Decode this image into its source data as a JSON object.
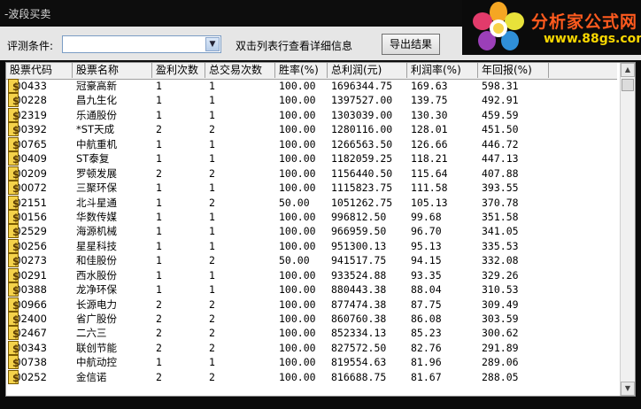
{
  "window": {
    "title": "-波段买卖"
  },
  "toolbar": {
    "condition_label": "评测条件:",
    "condition_value": "",
    "hint": "双击列表行查看详细信息",
    "export_label": "导出结果"
  },
  "logo": {
    "brand": "分析家公式网",
    "url": "www.88gs.com"
  },
  "table": {
    "columns": [
      "股票代码",
      "股票名称",
      "盈利次数",
      "总交易次数",
      "胜率(%)",
      "总利润(元)",
      "利润率(%)",
      "年回报(%)"
    ],
    "rows": [
      [
        "600433",
        "冠豪高新",
        "1",
        "1",
        "100.00",
        "1696344.75",
        "169.63",
        "598.31"
      ],
      [
        "600228",
        "昌九生化",
        "1",
        "1",
        "100.00",
        "1397527.00",
        "139.75",
        "492.91"
      ],
      [
        "002319",
        "乐通股份",
        "1",
        "1",
        "100.00",
        "1303039.00",
        "130.30",
        "459.59"
      ],
      [
        "600392",
        "*ST天成",
        "2",
        "2",
        "100.00",
        "1280116.00",
        "128.01",
        "451.50"
      ],
      [
        "600765",
        "中航重机",
        "1",
        "1",
        "100.00",
        "1266563.50",
        "126.66",
        "446.72"
      ],
      [
        "000409",
        "ST泰复",
        "1",
        "1",
        "100.00",
        "1182059.25",
        "118.21",
        "447.13"
      ],
      [
        "600209",
        "罗顿发展",
        "2",
        "2",
        "100.00",
        "1156440.50",
        "115.64",
        "407.88"
      ],
      [
        "300072",
        "三聚环保",
        "1",
        "1",
        "100.00",
        "1115823.75",
        "111.58",
        "393.55"
      ],
      [
        "002151",
        "北斗星通",
        "1",
        "2",
        "50.00",
        "1051262.75",
        "105.13",
        "370.78"
      ],
      [
        "000156",
        "华数传媒",
        "1",
        "1",
        "100.00",
        "996812.50",
        "99.68",
        "351.58"
      ],
      [
        "002529",
        "海源机械",
        "1",
        "1",
        "100.00",
        "966959.50",
        "96.70",
        "341.05"
      ],
      [
        "300256",
        "星星科技",
        "1",
        "1",
        "100.00",
        "951300.13",
        "95.13",
        "335.53"
      ],
      [
        "300273",
        "和佳股份",
        "1",
        "2",
        "50.00",
        "941517.75",
        "94.15",
        "332.08"
      ],
      [
        "600291",
        "西水股份",
        "1",
        "1",
        "100.00",
        "933524.88",
        "93.35",
        "329.26"
      ],
      [
        "600388",
        "龙净环保",
        "1",
        "1",
        "100.00",
        "880443.38",
        "88.04",
        "310.53"
      ],
      [
        "000966",
        "长源电力",
        "2",
        "2",
        "100.00",
        "877474.38",
        "87.75",
        "309.49"
      ],
      [
        "002400",
        "省广股份",
        "2",
        "2",
        "100.00",
        "860760.38",
        "86.08",
        "303.59"
      ],
      [
        "002467",
        "二六三",
        "2",
        "2",
        "100.00",
        "852334.13",
        "85.23",
        "300.62"
      ],
      [
        "300343",
        "联创节能",
        "2",
        "2",
        "100.00",
        "827572.50",
        "82.76",
        "291.89"
      ],
      [
        "000738",
        "中航动控",
        "1",
        "1",
        "100.00",
        "819554.63",
        "81.96",
        "289.06"
      ],
      [
        "300252",
        "金信诺",
        "2",
        "2",
        "100.00",
        "816688.75",
        "81.67",
        "288.05"
      ]
    ]
  },
  "colors": {
    "background": "#0b0b0b",
    "logo_brand": "#ff5a1e",
    "logo_url": "#f8d700"
  }
}
